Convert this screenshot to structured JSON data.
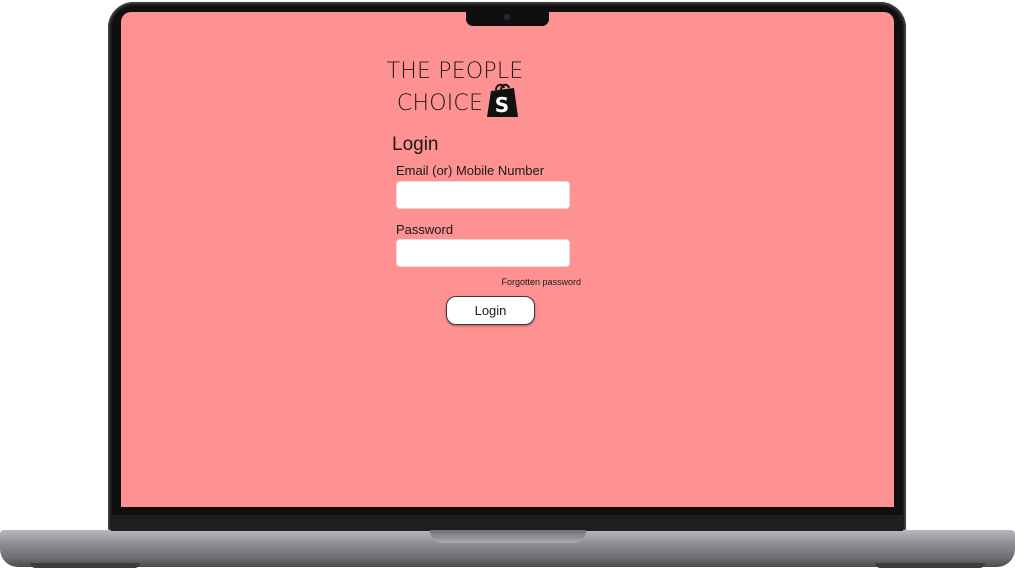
{
  "brand": {
    "line1": "THE PEOPLE",
    "line2": "CHOICE",
    "logo_icon": "shopping-bag-icon",
    "logo_letter": "S"
  },
  "login": {
    "title": "Login",
    "email_label": "Email (or) Mobile Number",
    "email_value": "",
    "email_placeholder": "",
    "password_label": "Password",
    "password_value": "",
    "password_placeholder": "",
    "forgot_link": "Forgotten password",
    "submit_label": "Login"
  },
  "colors": {
    "screen_background": "#fe9191",
    "input_background": "#ffffff",
    "text": "#1a1a1a"
  }
}
